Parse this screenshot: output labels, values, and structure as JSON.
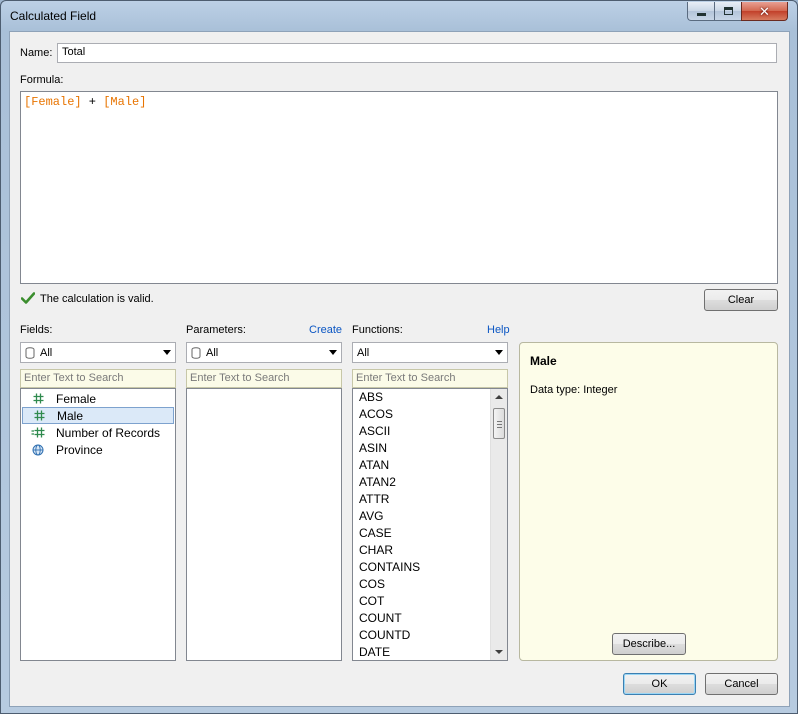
{
  "window": {
    "title": "Calculated Field",
    "close_glyph": "✕"
  },
  "name": {
    "label": "Name:",
    "value": "Total"
  },
  "formula": {
    "label": "Formula:",
    "tokens": [
      "[Female]",
      " + ",
      "[Male]"
    ]
  },
  "validation": {
    "message": "The calculation is valid.",
    "icon": "check-icon",
    "color": "#3b8e2e"
  },
  "buttons": {
    "clear": "Clear",
    "describe": "Describe...",
    "ok": "OK",
    "cancel": "Cancel"
  },
  "fields": {
    "label": "Fields:",
    "filter": "All",
    "search_placeholder": "Enter Text to Search",
    "items": [
      {
        "label": "Female",
        "icon": "number-icon"
      },
      {
        "label": "Male",
        "icon": "number-icon",
        "selected": true
      },
      {
        "label": "Number of Records",
        "icon": "number-calc-icon"
      },
      {
        "label": "Province",
        "icon": "globe-icon"
      }
    ]
  },
  "parameters": {
    "label": "Parameters:",
    "create_link": "Create",
    "filter": "All",
    "search_placeholder": "Enter Text to Search"
  },
  "functions": {
    "label": "Functions:",
    "help_link": "Help",
    "filter": "All",
    "search_placeholder": "Enter Text to Search",
    "items": [
      "ABS",
      "ACOS",
      "ASCII",
      "ASIN",
      "ATAN",
      "ATAN2",
      "ATTR",
      "AVG",
      "CASE",
      "CHAR",
      "CONTAINS",
      "COS",
      "COT",
      "COUNT",
      "COUNTD",
      "DATE"
    ]
  },
  "info": {
    "title": "Male",
    "data_type": "Data type: Integer"
  },
  "colors": {
    "field_token": "#e87400",
    "link": "#0b56c3",
    "selection": "#dbe9f8"
  }
}
